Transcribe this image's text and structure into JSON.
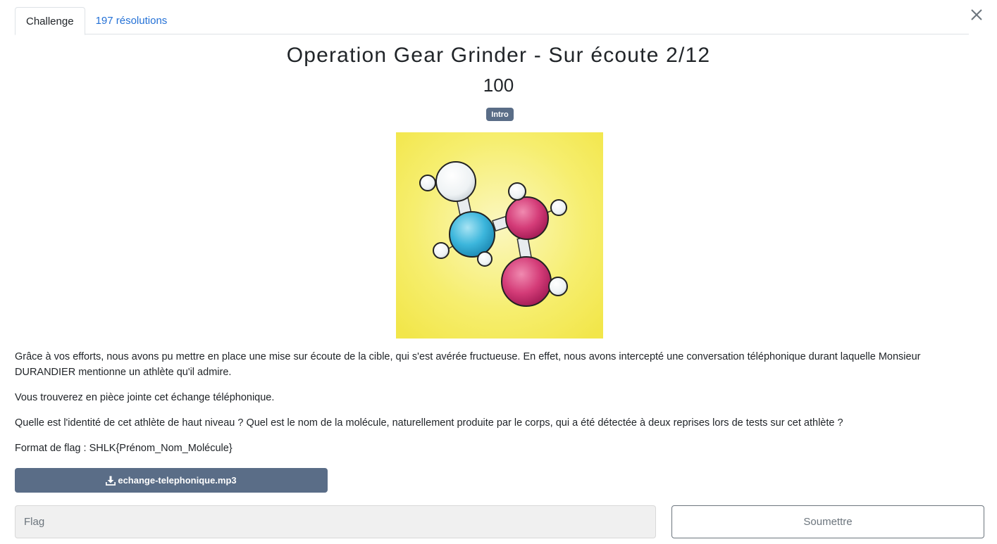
{
  "tabs": {
    "challenge": "Challenge",
    "solves": "197 résolutions"
  },
  "challenge": {
    "title": "Operation Gear Grinder - Sur écoute 2/12",
    "points": "100",
    "tag": "Intro"
  },
  "description": {
    "p1": "Grâce à vos efforts, nous avons pu mettre en place une mise sur écoute de la cible, qui s'est avérée fructueuse. En effet, nous avons intercepté une conversation téléphonique durant laquelle Monsieur DURANDIER mentionne un athlète qu'il admire.",
    "p2": "Vous trouverez en pièce jointe cet échange téléphonique.",
    "p3": "Quelle est l'identité de cet athlète de haut niveau ? Quel est le nom de la molécule, naturellement produite par le corps, qui a été détectée à deux reprises lors de tests sur cet athlète ?",
    "p4": "Format de flag : SHLK{Prénom_Nom_Molécule}"
  },
  "attachment": {
    "filename": "echange-telephonique.mp3",
    "icon": "download-icon"
  },
  "form": {
    "placeholder": "Flag",
    "submit_label": "Soumettre"
  },
  "colors": {
    "accent": "#5a6d87",
    "link": "#2471d6",
    "image_background": "#f7ef6a",
    "atom_blue": "#3cb6dc",
    "atom_magenta": "#cc2e6e"
  }
}
